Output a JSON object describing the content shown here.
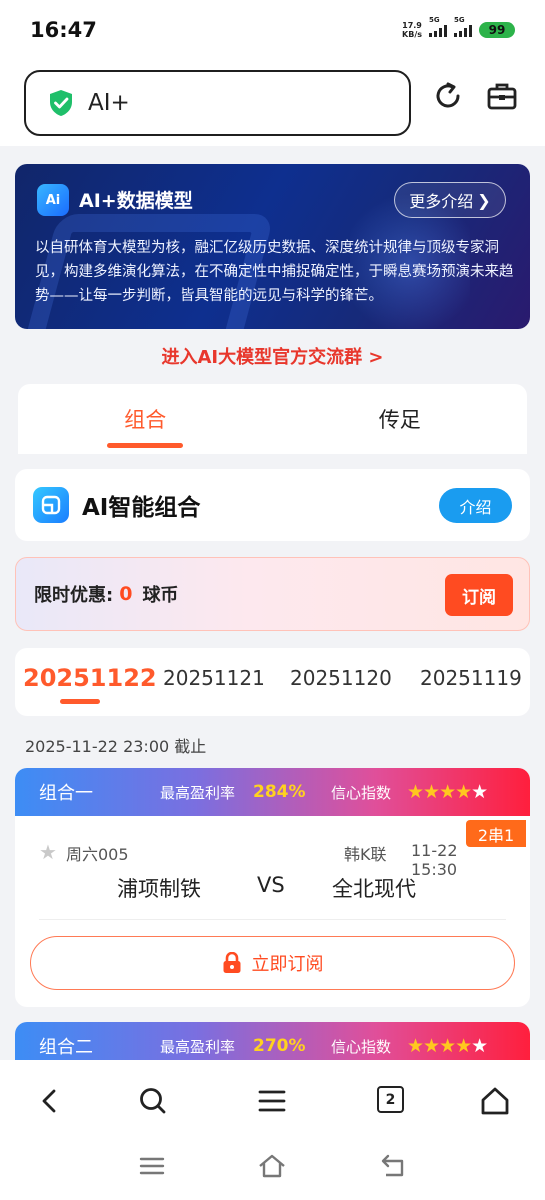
{
  "status": {
    "time": "16:47",
    "speed_top": "17.9",
    "speed_bottom": "KB/s",
    "net1": "5G",
    "net2": "5G",
    "battery": "99"
  },
  "address": {
    "text": "AI+"
  },
  "banner": {
    "title": "AI+数据模型",
    "more_label": "更多介绍",
    "description": "以自研体育大模型为核，融汇亿级历史数据、深度统计规律与顶级专家洞见，构建多维演化算法，在不确定性中捕捉确定性，于瞬息赛场预演未来趋势——让每一步判断，皆具智能的远见与科学的锋芒。",
    "logo_text": "Ai"
  },
  "join_link": "进入AI大模型官方交流群 >",
  "tabs": [
    {
      "label": "组合"
    },
    {
      "label": "传足"
    }
  ],
  "ai_section": {
    "title": "AI智能组合",
    "intro_label": "介绍"
  },
  "promo": {
    "label": "限时优惠:",
    "price": "0",
    "unit": "球币",
    "subscribe_label": "订阅"
  },
  "dates": [
    "20251122",
    "20251121",
    "20251120",
    "20251119"
  ],
  "deadline": "2025-11-22 23:00 截止",
  "combos": [
    {
      "name": "组合一",
      "rate_label": "最高盈利率",
      "rate": "284%",
      "conf_label": "信心指数",
      "stars": 4,
      "match": {
        "no": "周六005",
        "league": "韩K联",
        "time": "11-22 15:30",
        "badge": "2串1",
        "home": "浦项制铁",
        "vs": "VS",
        "away": "全北现代"
      },
      "button": "立即订阅"
    },
    {
      "name": "组合二",
      "rate_label": "最高盈利率",
      "rate": "270%",
      "conf_label": "信心指数",
      "stars": 4
    }
  ],
  "nav": {
    "tab_count": "2"
  },
  "colors": {
    "accent": "#ff5a2c",
    "blue": "#1a9cf0",
    "star": "#ffc81f"
  }
}
